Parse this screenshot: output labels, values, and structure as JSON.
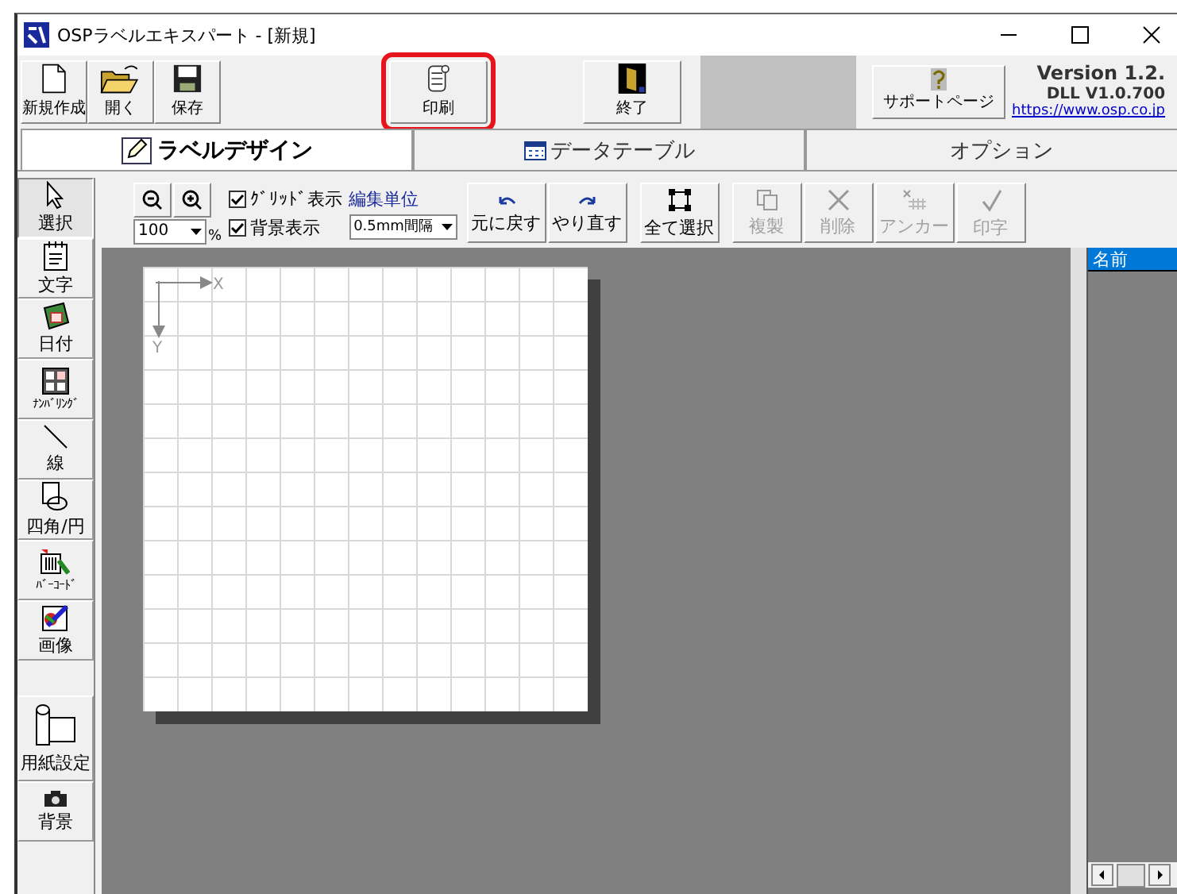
{
  "window": {
    "title": "OSPラベルエキスパート - [新規]"
  },
  "toolbar": [
    {
      "label": "新規作成",
      "kind": "new",
      "highlighted": false
    },
    {
      "label": "開く",
      "kind": "open",
      "highlighted": false
    },
    {
      "label": "保存",
      "kind": "save",
      "highlighted": false
    },
    {
      "label": "印刷",
      "kind": "print",
      "highlighted": true
    },
    {
      "label": "終了",
      "kind": "exit",
      "highlighted": false
    }
  ],
  "support_button": "サポートページ",
  "version": "Version 1.2.",
  "dll": "DLL V1.0.700",
  "link": "https://www.osp.co.jp",
  "tabs": [
    {
      "label": "ラベルデザイン",
      "kind": "design",
      "selected": true
    },
    {
      "label": "データテーブル",
      "kind": "table",
      "selected": false
    },
    {
      "label": "オプション",
      "kind": "plain",
      "selected": false
    }
  ],
  "palette": [
    {
      "label": "選択",
      "kind": "pointer",
      "selected": true
    },
    {
      "label": "文字",
      "kind": "text",
      "selected": false
    },
    {
      "label": "日付",
      "kind": "date",
      "selected": false
    },
    {
      "label": "ﾅﾝﾊﾞﾘﾝｸﾞ",
      "kind": "number",
      "selected": false
    },
    {
      "label": "線",
      "kind": "line",
      "selected": false
    },
    {
      "label": "四角/円",
      "kind": "shape",
      "selected": false
    },
    {
      "label": "ﾊﾞｰｺｰﾄﾞ",
      "kind": "barcode",
      "selected": false
    },
    {
      "label": "画像",
      "kind": "image",
      "selected": false
    },
    {
      "label": "用紙設定",
      "kind": "paper",
      "selected": false
    },
    {
      "label": "背景",
      "kind": "camera",
      "selected": false
    }
  ],
  "zoom": {
    "value": "100",
    "unit": "%"
  },
  "checkboxes": [
    {
      "label": "ｸﾞﾘｯﾄﾞ表示",
      "checked": true
    },
    {
      "label": "背景表示",
      "checked": true
    }
  ],
  "edit_unit": {
    "label": "編集単位",
    "value": "0.5mm間隔"
  },
  "edit_buttons": [
    {
      "label": "元に戻す",
      "kind": "undo",
      "disabled": false
    },
    {
      "label": "やり直す",
      "kind": "redo",
      "disabled": false
    },
    {
      "label": "全て選択",
      "kind": "selectall",
      "disabled": false
    },
    {
      "label": "複製",
      "kind": "copy",
      "disabled": true
    },
    {
      "label": "削除",
      "kind": "delete",
      "disabled": true
    },
    {
      "label": "アンカー",
      "kind": "anchor",
      "disabled": true
    },
    {
      "label": "印字",
      "kind": "printflag",
      "disabled": true
    }
  ],
  "canvas": {
    "x_label": "X",
    "y_label": "Y"
  },
  "list": {
    "header": "名前",
    "selected": true
  }
}
